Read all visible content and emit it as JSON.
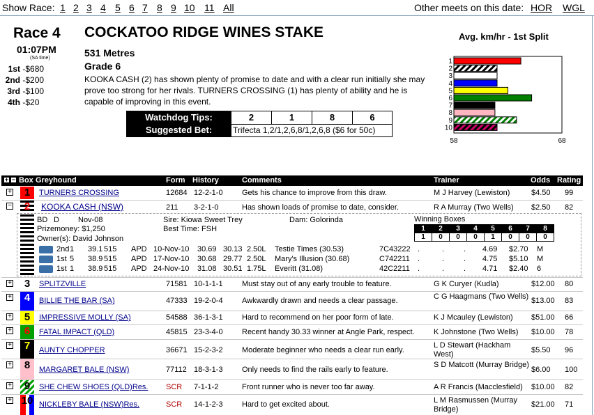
{
  "nav": {
    "show_race_label": "Show Race:",
    "races": [
      "1",
      "2",
      "3",
      "4",
      "5",
      "6",
      "7",
      "8",
      "9",
      "10",
      "11",
      "All"
    ],
    "other_meets_label": "Other meets on this date:",
    "other_meets": [
      "HOR",
      "WGL"
    ]
  },
  "race": {
    "number_label": "Race 4",
    "time": "01:07PM",
    "time_zone": "(SA time)",
    "prizes": [
      {
        "pos": "1st",
        "amt": "-$680"
      },
      {
        "pos": "2nd",
        "amt": "-$200"
      },
      {
        "pos": "3rd",
        "amt": "-$100"
      },
      {
        "pos": "4th",
        "amt": "-$20"
      }
    ],
    "name": "COCKATOO RIDGE WINES STAKE",
    "distance": "531 Metres",
    "grade": "Grade 6",
    "description": "KOOKA CASH (2) has shown plenty of promise to date and with a clear run initially she may prove too strong for her rivals. TURNERS CROSSING (1) has plenty of ability and he is capable of improving in this event."
  },
  "tips": {
    "watchdog_label": "Watchdog Tips:",
    "watchdog_values": [
      "2",
      "1",
      "8",
      "6"
    ],
    "bet_label": "Suggested Bet:",
    "bet_value": "Trifecta 1,2/1,2,6,8/1,2,6,8 ($6 for 50c)"
  },
  "chart_data": {
    "type": "bar",
    "title": "Avg. km/hr - 1st Split",
    "orientation": "horizontal",
    "categories": [
      "1",
      "2",
      "3",
      "4",
      "5",
      "6",
      "7",
      "8",
      "9",
      "10"
    ],
    "values": [
      64.2,
      62.0,
      62.0,
      62.0,
      63.0,
      65.2,
      61.8,
      61.8,
      63.8,
      62.0
    ],
    "xlim": [
      58,
      68
    ],
    "xticks": [
      "58",
      "68"
    ],
    "colors": [
      "#ff0000",
      "#000000",
      "#ffffff",
      "#0000ff",
      "#ffff00",
      "#008000",
      "#000000",
      "#ffb6c1",
      "#008000",
      "#cc0066"
    ],
    "patterns": [
      "solid",
      "stripe-bw",
      "solid",
      "solid",
      "solid",
      "solid",
      "solid",
      "solid",
      "stripe-gw",
      "stripe-mb"
    ]
  },
  "table": {
    "headers": [
      "Box",
      "Greyhound",
      "Form",
      "History",
      "Comments",
      "Trainer",
      "Odds",
      "Rating"
    ],
    "rows": [
      {
        "box": "1",
        "name": "TURNERS CROSSING",
        "form": "12684",
        "hist": "12-2-1-0",
        "cmt": "Gets his chance to improve from this draw.",
        "trainer": "M J Harvey (Lewiston)",
        "odds": "$4.50",
        "rating": "99",
        "toggle": "+"
      },
      {
        "box": "2",
        "name": "KOOKA CASH (NSW)",
        "form": "211",
        "hist": "3-2-1-0",
        "cmt": "Has shown loads of promise to date, consider.",
        "trainer": "R A Murray (Two Wells)",
        "odds": "$2.50",
        "rating": "82",
        "toggle": "−"
      },
      {
        "box": "3",
        "name": "SPLITZVILLE",
        "form": "71581",
        "hist": "10-1-1-1",
        "cmt": "Must stay out of any early trouble to feature.",
        "trainer": "G K Curyer (Kudla)",
        "odds": "$12.00",
        "rating": "80",
        "toggle": "+"
      },
      {
        "box": "4",
        "name": "BILLIE THE BAR (SA)",
        "form": "47333",
        "hist": "19-2-0-4",
        "cmt": "Awkwardly drawn and needs a clear passage.",
        "trainer": "C G Haagmans (Two Wells)",
        "odds": "$13.00",
        "rating": "83",
        "toggle": "+"
      },
      {
        "box": "5",
        "name": "IMPRESSIVE MOLLY (SA)",
        "form": "54588",
        "hist": "36-1-3-1",
        "cmt": "Hard to recommend on her poor form of late.",
        "trainer": "K J Mcauley (Lewiston)",
        "odds": "$51.00",
        "rating": "66",
        "toggle": "+"
      },
      {
        "box": "6",
        "name": "FATAL IMPACT (QLD)",
        "form": "45815",
        "hist": "23-3-4-0",
        "cmt": "Recent handy 30.33 winner at Angle Park, respect.",
        "trainer": "K Johnstone (Two Wells)",
        "odds": "$10.00",
        "rating": "78",
        "toggle": "+"
      },
      {
        "box": "7",
        "name": "AUNTY CHOPPER",
        "form": "36671",
        "hist": "15-2-3-2",
        "cmt": "Moderate beginner who needs a clear run early.",
        "trainer": "L D Stewart (Hackham West)",
        "odds": "$5.50",
        "rating": "96",
        "toggle": "+"
      },
      {
        "box": "8",
        "name": "MARGARET BALE (NSW)",
        "form": "77112",
        "hist": "18-3-1-3",
        "cmt": "Only needs to find the rails early to feature.",
        "trainer": "S D Matcott (Murray Bridge)",
        "odds": "$6.00",
        "rating": "100",
        "toggle": "+"
      },
      {
        "box": "9",
        "name": "SHE CHEW SHOES (QLD)Res.",
        "form": "SCR",
        "hist": "7-1-1-2",
        "cmt": "Front runner who is never too far away.",
        "trainer": "A R Francis (Macclesfield)",
        "odds": "$10.00",
        "rating": "82",
        "toggle": "+"
      },
      {
        "box": "10",
        "name": "NICKLEBY BALE (NSW)Res.",
        "form": "SCR",
        "hist": "14-1-2-3",
        "cmt": "Hard to get excited about.",
        "trainer": "L M Rasmussen (Murray Bridge)",
        "odds": "$21.00",
        "rating": "71",
        "toggle": "+"
      }
    ]
  },
  "detail": {
    "color": "BD",
    "sex": "D",
    "whelped": "Nov-08",
    "sire": "Sire: Kiowa Sweet Trey",
    "dam": "Dam: Golorinda",
    "prize": "Prizemoney: $1,250",
    "best": "Best Time: FSH",
    "owner": "Owner(s): David Johnson",
    "winning_boxes_label": "Winning Boxes",
    "winning_boxes_nums": [
      "1",
      "2",
      "3",
      "4",
      "5",
      "6",
      "7",
      "8"
    ],
    "winning_boxes_vals": [
      "1",
      "0",
      "0",
      "0",
      "1",
      "0",
      "0",
      "0"
    ],
    "runs": [
      [
        "2nd",
        "1",
        "39.1",
        "515",
        "APD",
        "10-Nov-10",
        "30.69",
        "30.13",
        "2.50L",
        "Testie Times (30.53)",
        "7C43222",
        ".",
        ".",
        ".",
        "4.69",
        "$2.70",
        "M"
      ],
      [
        "1st",
        "5",
        "38.9",
        "515",
        "APD",
        "17-Nov-10",
        "30.68",
        "29.77",
        "2.50L",
        "Mary's Illusion (30.68)",
        "C742211",
        ".",
        ".",
        ".",
        "4.75",
        "$5.10",
        "M"
      ],
      [
        "1st",
        "1",
        "38.9",
        "515",
        "APD",
        "24-Nov-10",
        "31.08",
        "30.51",
        "1.75L",
        "Everitt (31.08)",
        "42C2211",
        ".",
        ".",
        ".",
        "4.71",
        "$2.40",
        "6"
      ]
    ]
  }
}
